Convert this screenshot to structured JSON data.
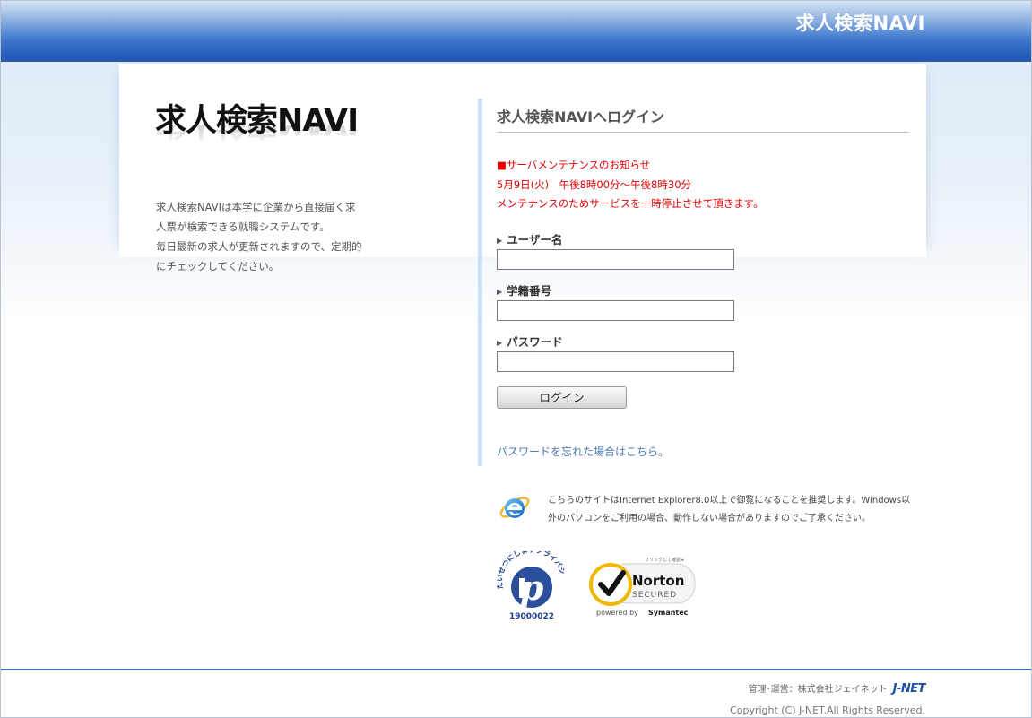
{
  "header": {
    "title": "求人検索NAVI"
  },
  "brand": {
    "logo_text": "求人検索NAVI",
    "description_lines": [
      "求人検索NAVIは本学に企業から直接届く求",
      "人票が検索できる就職システムです。",
      "毎日最新の求人が更新されますので、定期的",
      "にチェックしてください。"
    ]
  },
  "login": {
    "title": "求人検索NAVIへログイン",
    "notice_lines": [
      "■サーバメンテナンスのお知らせ",
      "5月9日(火)　午後8時00分～午後8時30分",
      "メンテナンスのためサービスを一時停止させて頂きます。"
    ],
    "fields": [
      {
        "label": "ユーザー名",
        "value": ""
      },
      {
        "label": "学籍番号",
        "value": ""
      },
      {
        "label": "パスワード",
        "value": ""
      }
    ],
    "button_label": "ログイン",
    "forgot_link": "パスワードを忘れた場合はこちら。"
  },
  "browser_notice": {
    "icon": "internet-explorer-icon",
    "lines": [
      "こちらのサイトはInternet Explorer8.0以上で御覧になることを推奨します。Windows以",
      "外のパソコンをご利用の場合、動作しない場合がありますのでご了承ください。"
    ]
  },
  "badges": {
    "privacy_mark": {
      "arc_text": "たいせつにしますプライバシー",
      "number": "19000022"
    },
    "norton": {
      "top_text": "クリックして確認 ▸",
      "name": "Norton",
      "secured": "SECURED",
      "powered_by": "powered by",
      "vendor": "Symantec"
    }
  },
  "footer": {
    "operator": "管理･運営：株式会社ジェイネット",
    "operator_logo": "J-NET",
    "copyright": "Copyright (C) J-NET.All Rights Reserved."
  },
  "colors": {
    "header_blue": "#1f55b4",
    "notice_red": "#e60000",
    "link_blue": "#4c7bb5",
    "accent_bar": "#c9e1f6"
  }
}
